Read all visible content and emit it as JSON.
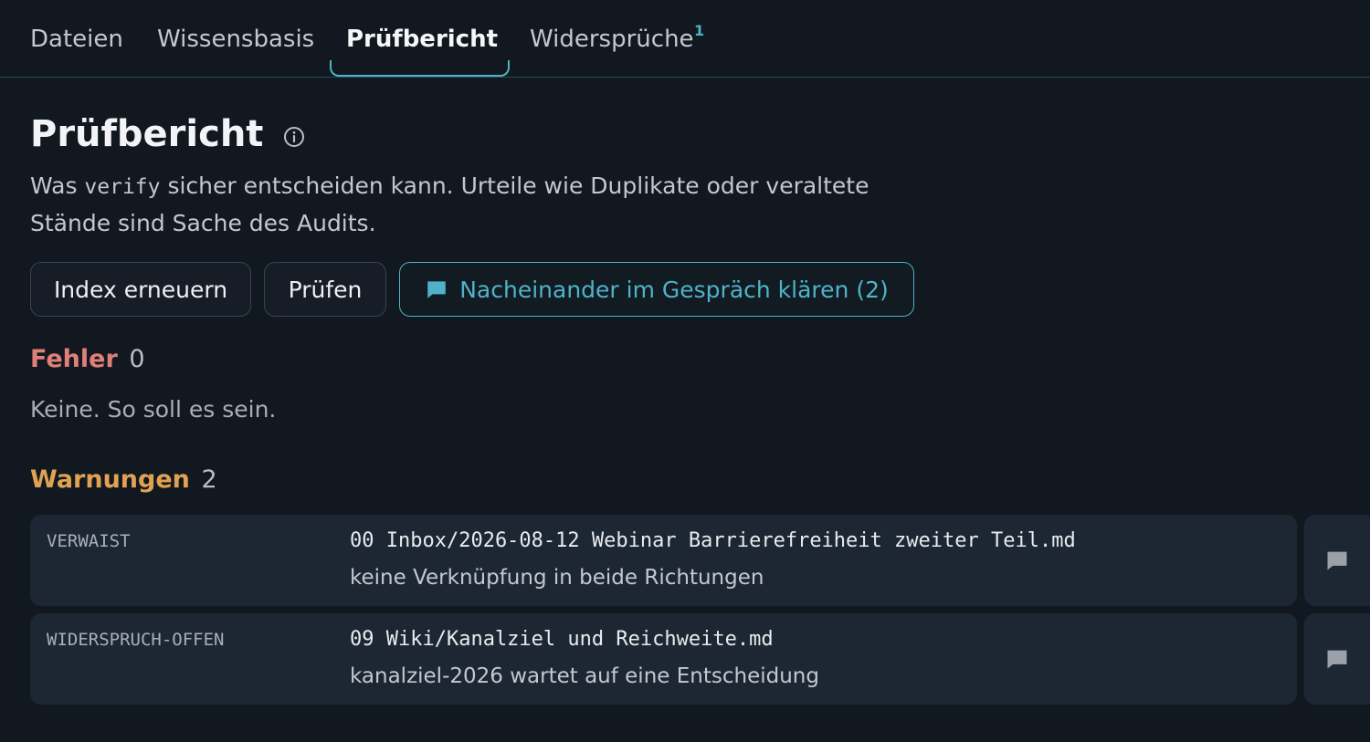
{
  "tabs": [
    {
      "label": "Dateien",
      "active": false
    },
    {
      "label": "Wissensbasis",
      "active": false
    },
    {
      "label": "Prüfbericht",
      "active": true
    },
    {
      "label": "Widersprüche",
      "active": false,
      "badge": "1"
    }
  ],
  "page": {
    "title": "Prüfbericht",
    "info_icon": "info-circle-icon",
    "description": {
      "before": "Was ",
      "code": "verify",
      "after": " sicher entscheiden kann. Urteile wie Duplikate oder veraltete Stände sind Sache des Audits."
    }
  },
  "actions": {
    "reindex_label": "Index erneuern",
    "verify_label": "Prüfen",
    "discuss_label": "Nacheinander im Gespräch klären (2)",
    "discuss_icon": "chat-bubble-icon"
  },
  "errors": {
    "label": "Fehler",
    "count": "0",
    "empty_message": "Keine. So soll es sein."
  },
  "warnings": {
    "label": "Warnungen",
    "count": "2",
    "items": [
      {
        "code": "VERWAIST",
        "path": "00 Inbox/2026-08-12 Webinar Barrierefreiheit zweiter Teil.md",
        "message": "keine Verknüpfung in beide Richtungen"
      },
      {
        "code": "WIDERSPRUCH-OFFEN",
        "path": "09 Wiki/Kanalziel und Reichweite.md",
        "message": "kanalziel-2026 wartet auf eine Entscheidung"
      }
    ]
  },
  "colors": {
    "accent": "#4fb3c8",
    "error": "#e08079",
    "warning": "#e0a252",
    "background": "#121820",
    "card": "#1d2733"
  }
}
